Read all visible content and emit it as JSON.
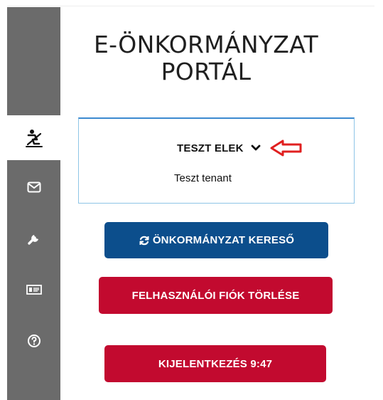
{
  "header": {
    "title_line1": "E-ÖNKORMÁNYZAT",
    "title_line2": "PORTÁL"
  },
  "sidebar": {
    "items": [
      {
        "icon": "person-eraser-icon",
        "active": true
      },
      {
        "icon": "envelope-icon",
        "active": false
      },
      {
        "icon": "wrench-icon",
        "active": false
      },
      {
        "icon": "id-card-icon",
        "active": false
      },
      {
        "icon": "help-icon",
        "active": false
      }
    ]
  },
  "user": {
    "name": "TESZT ELEK",
    "tenant": "Teszt tenant"
  },
  "buttons": {
    "search_label": "ÖNKORMÁNYZAT KERESŐ",
    "delete_label": "FELHASZNÁLÓI FIÓK TÖRLÉSE",
    "logout_label": "KIJELENTKEZÉS 9:47"
  },
  "colors": {
    "sidebar": "#6b6b6b",
    "primary_blue": "#0c4e8c",
    "danger_red": "#c20a2f",
    "box_border": "#8ec5e6",
    "annotation_arrow": "#e02020"
  }
}
